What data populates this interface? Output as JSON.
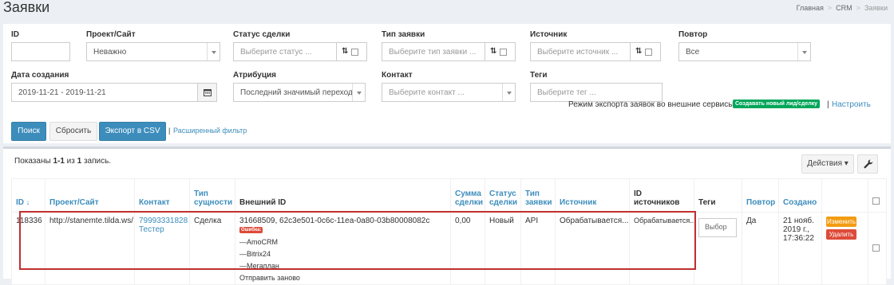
{
  "page": {
    "title": "Заявки"
  },
  "breadcrumb": [
    "Главная",
    "CRM",
    "Заявки"
  ],
  "filters": {
    "id_label": "ID",
    "project_label": "Проект/Сайт",
    "project_value": "Неважно",
    "status_label": "Статус сделки",
    "status_placeholder": "Выберите статус ...",
    "type_label": "Тип заявки",
    "type_placeholder": "Выберите тип заявки ...",
    "source_label": "Источник",
    "source_placeholder": "Выберите источник ...",
    "repeat_label": "Повтор",
    "repeat_value": "Все",
    "created_label": "Дата создания",
    "created_value": "2019-11-21 - 2019-11-21",
    "attribution_label": "Атрибуция",
    "attribution_value": "Последний значимый переход",
    "contact_label": "Контакт",
    "contact_placeholder": "Выберите контакт ...",
    "tags_label": "Теги",
    "tags_placeholder": "Выберите тег ...",
    "sort_arrows": "⇅"
  },
  "buttons": {
    "search": "Поиск",
    "reset": "Сбросить",
    "export_csv": "Экспорт в CSV",
    "advanced_filter": "Расширенный фильтр",
    "pipe": "|"
  },
  "export": {
    "label": "Режим экспорта заявок во внешние сервисы:",
    "badge": "Создавать новый лид/сделку",
    "pipe": "|",
    "settings_link": "Настроить"
  },
  "grid": {
    "summary_prefix": "Показаны ",
    "summary_range": "1-1",
    "summary_mid": " из ",
    "summary_total": "1",
    "summary_suffix": " запись.",
    "actions_label": "Действия ▾",
    "columns": {
      "id": "ID",
      "project": "Проект/Сайт",
      "contact": "Контакт",
      "entity_type": "Тип сущности",
      "external_id": "Внешний ID",
      "amount": "Сумма сделки",
      "status": "Статус сделки",
      "request_type": "Тип заявки",
      "source": "Источник",
      "source_id": "ID источников",
      "tags": "Теги",
      "repeat": "Повтор",
      "created": "Создано"
    },
    "row": {
      "id": "118336",
      "project": "http://stanemte.tilda.ws/",
      "contact_phone": "79993331828",
      "contact_name": "Тестер",
      "entity_type": "Сделка",
      "external_id": "31668509, 62c3e501-0c6c-11ea-0a80-03b80008082c",
      "error_badge": "Ошибка:",
      "services": [
        "—AmoCRM",
        "—Bitrix24",
        "—Мегаплан"
      ],
      "resend_link": "Отправить заново",
      "amount": "0,00",
      "status": "Новый",
      "request_type": "API",
      "source": "Обрабатывается...",
      "source_id": "Обрабатывается...",
      "tags_button": "Выбор",
      "repeat": "Да",
      "created_date": "21 нояб. 2019 г.,",
      "created_time": "17:36:22",
      "edit_button": "Изменить",
      "delete_button": "Удалить"
    }
  },
  "colors": {
    "primary": "#3c8dbc",
    "success": "#00a65a",
    "warning": "#f39c12",
    "danger": "#dd4b39",
    "highlight_border": "#c0302e"
  }
}
